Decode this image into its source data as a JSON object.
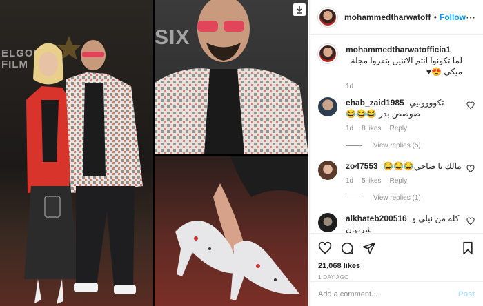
{
  "media": {
    "backdrop_text_left": "ELGOUN\nFILM",
    "backdrop_text_right": "SIX",
    "download_icon": "download-arrow-icon"
  },
  "header": {
    "username": "mohammedtharwatofficia",
    "separator": "•",
    "follow_label": "Follow",
    "more_icon": "ellipsis-icon"
  },
  "caption": {
    "username": "mohammedtharwatofficia1",
    "text": "لما تكونوا انتم الاتنين بتقروا مجلة ميكي 😍♥",
    "time": "1d"
  },
  "comments": [
    {
      "username": "ehab_zaid1985",
      "text": "تكوووونيي صوصص بدر 😂😂😂",
      "time": "1d",
      "likes": "8 likes",
      "reply_label": "Reply",
      "view_replies": "View replies (5)"
    },
    {
      "username": "zo47553",
      "text": "مالك يا ضاحي😂😂😂",
      "time": "1d",
      "likes": "5 likes",
      "reply_label": "Reply",
      "view_replies": "View replies (1)"
    },
    {
      "username": "alkhateb200516",
      "text": "كله من نيلي و شريهان",
      "time": "",
      "likes": "",
      "reply_label": "",
      "view_replies": ""
    }
  ],
  "actions": {
    "like_icon": "heart-icon",
    "comment_icon": "comment-icon",
    "share_icon": "paper-plane-icon",
    "save_icon": "bookmark-icon",
    "likes_count": "21,068 likes",
    "posted_time": "1 DAY AGO"
  },
  "add_comment": {
    "placeholder": "Add a comment...",
    "post_label": "Post"
  },
  "colors": {
    "accent": "#0095f6",
    "post_disabled": "#b2dffc",
    "muted": "#8e8e8e"
  }
}
